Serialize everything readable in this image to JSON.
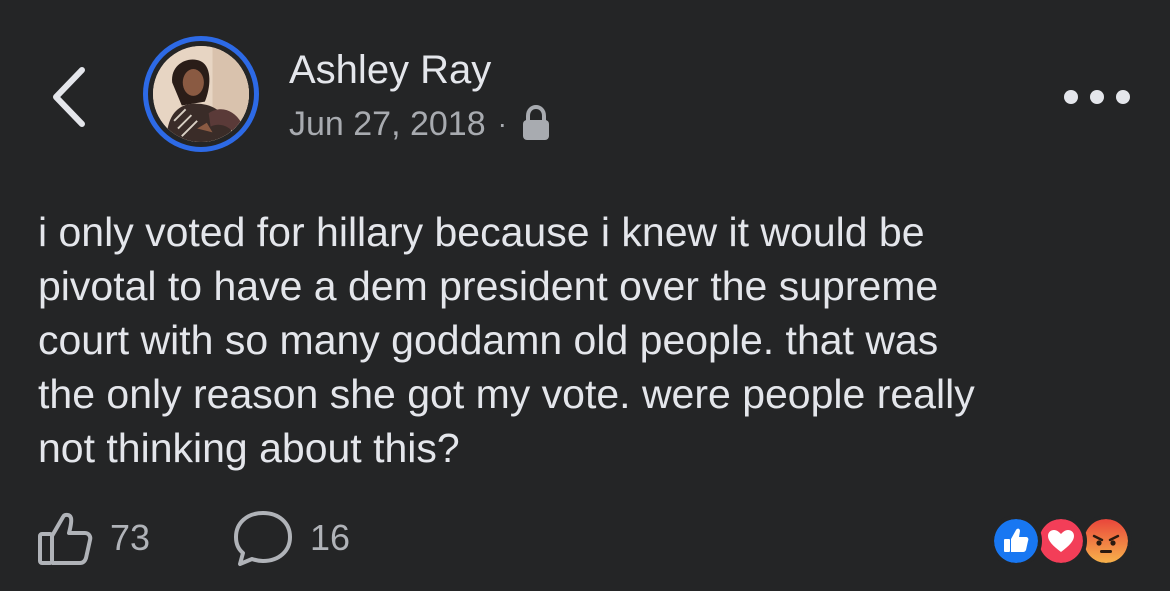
{
  "header": {
    "back_icon": "chevron-left-icon",
    "author_name": "Ashley Ray",
    "date": "Jun 27, 2018",
    "separator": "·",
    "privacy_icon": "lock-icon",
    "more_icon": "more-horizontal-icon"
  },
  "post": {
    "text_lines": [
      "i only voted for hillary because i knew it would be",
      "pivotal to have a dem president over the supreme",
      "court with so many goddamn old people. that was",
      "the only reason she got my vote. were people really",
      "not thinking about this?"
    ]
  },
  "footer": {
    "like_icon": "thumbs-up-icon",
    "like_count": "73",
    "comment_icon": "comment-bubble-icon",
    "comment_count": "16",
    "reaction_icons": [
      "like-reaction-icon",
      "love-reaction-icon",
      "angry-reaction-icon"
    ]
  },
  "colors": {
    "background": "#242526",
    "avatar_ring": "#2d6ae6",
    "primary_text": "#e4e6eb",
    "secondary_text": "#a8abb0",
    "like_blue": "#1877f2",
    "love_red": "#f33e58",
    "angry_orange": "#f7714b"
  }
}
